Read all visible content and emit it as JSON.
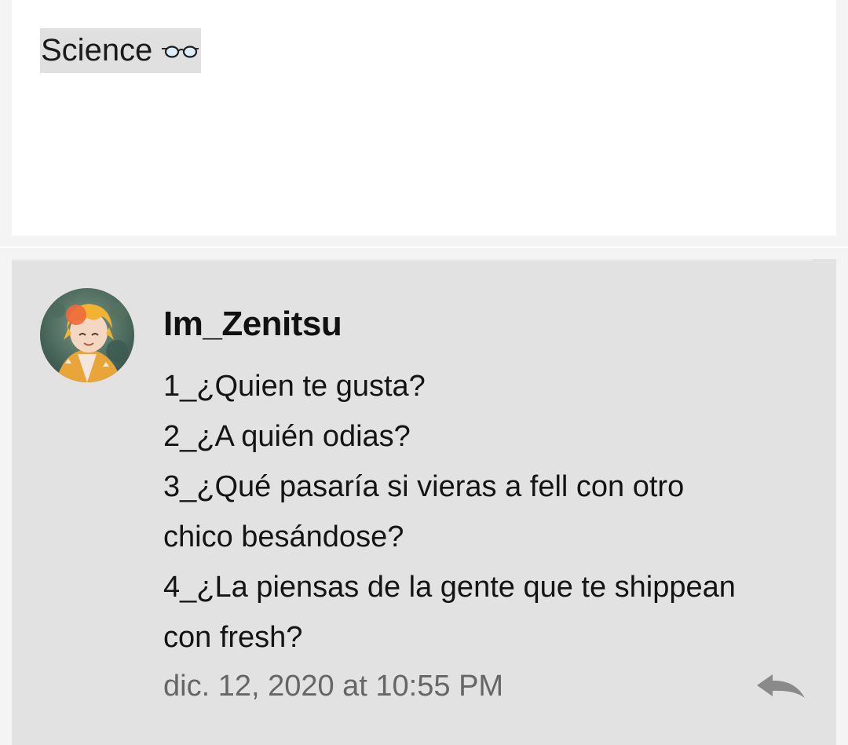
{
  "tag": {
    "label": "Science",
    "icon": "glasses-icon"
  },
  "comment": {
    "author": "Im_Zenitsu",
    "avatar_icon": "avatar",
    "lines": [
      "1_¿Quien te gusta?",
      "2_¿A quién odias?",
      "3_¿Qué pasaría si vieras a fell con otro",
      "chico besándose?",
      "4_¿La piensas de la gente que te shippean",
      "con fresh?"
    ],
    "timestamp": "dic. 12, 2020 at 10:55 PM",
    "reply_icon": "reply-icon"
  },
  "colors": {
    "page_background": "#f4f4f4",
    "card_background": "#ffffff",
    "comment_background": "#e2e2e2",
    "chip_background": "#e0e0e0",
    "timestamp_text": "#666666",
    "reply_icon": "#8a8a8a"
  }
}
